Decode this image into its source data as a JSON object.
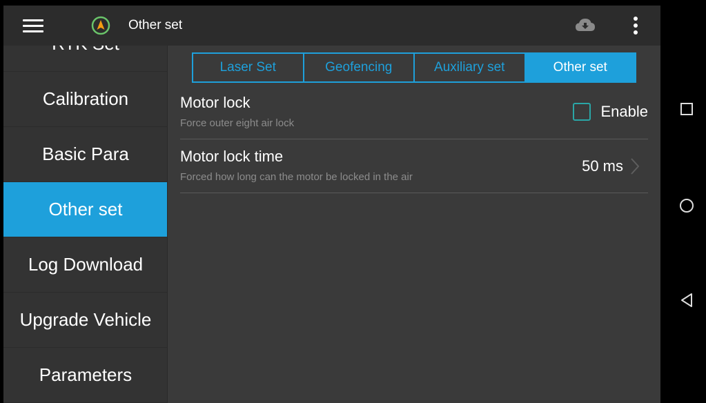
{
  "app_bar": {
    "title": "Other set"
  },
  "sidebar": {
    "items": [
      {
        "label": "RTK Set"
      },
      {
        "label": "Calibration"
      },
      {
        "label": "Basic Para"
      },
      {
        "label": "Other set"
      },
      {
        "label": "Log Download"
      },
      {
        "label": "Upgrade Vehicle"
      },
      {
        "label": "Parameters"
      }
    ]
  },
  "tabs": [
    {
      "label": "Laser Set"
    },
    {
      "label": "Geofencing"
    },
    {
      "label": "Auxiliary set"
    },
    {
      "label": "Other set"
    }
  ],
  "settings": {
    "motor_lock": {
      "title": "Motor lock",
      "subtitle": "Force outer eight air lock",
      "enable_label": "Enable",
      "checked": false
    },
    "motor_lock_time": {
      "title": "Motor lock time",
      "subtitle": "Forced how long can the motor be locked in the air",
      "value": "50 ms"
    }
  },
  "colors": {
    "accent": "#1ea0db",
    "checkbox_border": "#2aa6a6",
    "nav_icon": "#f39c12"
  },
  "icons": [
    "menu-icon",
    "navigation-icon",
    "cloud-download-icon",
    "more-vert-icon",
    "chevron-right-icon",
    "recents-icon",
    "home-icon",
    "back-icon"
  ]
}
